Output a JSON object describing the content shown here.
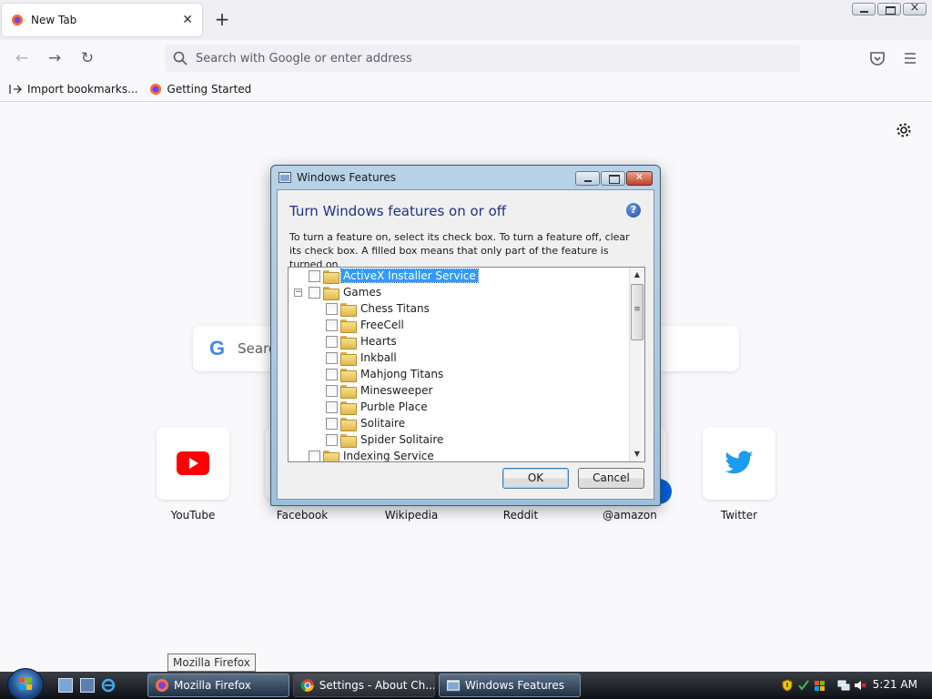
{
  "browser": {
    "tab": {
      "title": "New Tab"
    },
    "urlbar": {
      "placeholder": "Search with Google or enter address"
    },
    "bookmarks": [
      {
        "label": "Import bookmarks..."
      },
      {
        "label": "Getting Started"
      }
    ]
  },
  "newtab": {
    "search_placeholder": "Search",
    "tiles": [
      {
        "label": "YouTube"
      },
      {
        "label": "Facebook"
      },
      {
        "label": "Wikipedia"
      },
      {
        "label": "Reddit"
      },
      {
        "label": "@amazon"
      },
      {
        "label": "Twitter"
      }
    ]
  },
  "dialog": {
    "title": "Windows Features",
    "heading": "Turn Windows features on or off",
    "description": "To turn a feature on, select its check box. To turn a feature off, clear its check box. A filled box means that only part of the feature is turned on.",
    "help": "?",
    "features": [
      {
        "label": "ActiveX Installer Service",
        "level": 0,
        "selected": true
      },
      {
        "label": "Games",
        "level": 0,
        "expander": "−"
      },
      {
        "label": "Chess Titans",
        "level": 1
      },
      {
        "label": "FreeCell",
        "level": 1
      },
      {
        "label": "Hearts",
        "level": 1
      },
      {
        "label": "Inkball",
        "level": 1
      },
      {
        "label": "Mahjong Titans",
        "level": 1
      },
      {
        "label": "Minesweeper",
        "level": 1
      },
      {
        "label": "Purble Place",
        "level": 1
      },
      {
        "label": "Solitaire",
        "level": 1
      },
      {
        "label": "Spider Solitaire",
        "level": 1
      },
      {
        "label": "Indexing Service",
        "level": 0
      }
    ],
    "ok": "OK",
    "cancel": "Cancel"
  },
  "taskbar": {
    "tooltip": "Mozilla Firefox",
    "tasks": [
      {
        "label": "Mozilla Firefox"
      },
      {
        "label": "Settings - About Ch..."
      },
      {
        "label": "Windows Features"
      }
    ],
    "clock": "5:21 AM"
  },
  "colors": {
    "accent": "#0060df",
    "dialog_heading": "#1e3287",
    "selection": "#3399ff",
    "youtube": "#ff0000",
    "twitter": "#1d9bf0"
  }
}
